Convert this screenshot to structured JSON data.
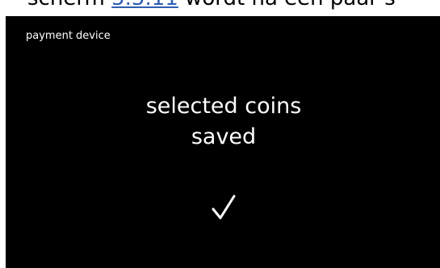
{
  "document": {
    "before_link": "scherm ",
    "link_text": "5.5.11",
    "after_link": " wordt na een paar s"
  },
  "screen": {
    "header": "payment device",
    "message_line1": "selected coins",
    "message_line2": "saved",
    "icon": "checkmark-icon",
    "background_color": "#000000",
    "text_color": "#ffffff"
  }
}
